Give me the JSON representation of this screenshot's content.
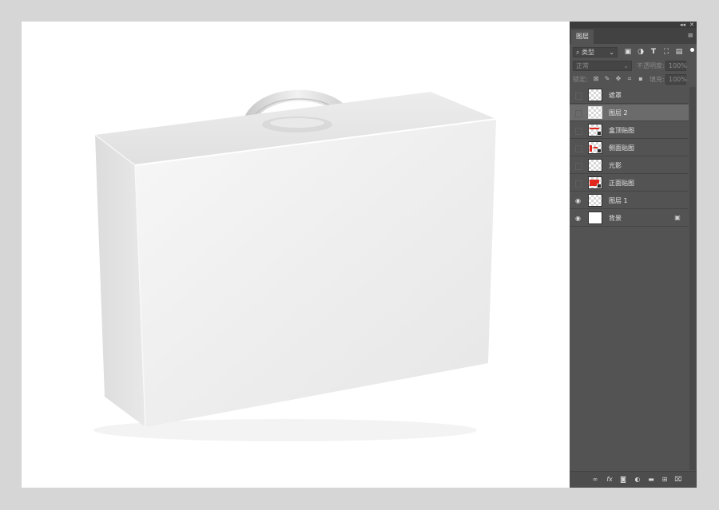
{
  "panel": {
    "collapse_glyph": "◂◂",
    "close_glyph": "✕",
    "tab_label": "图层",
    "menu_icon": "≡",
    "filter": {
      "kind_label": "类型",
      "icons": [
        "image-filter-icon",
        "adjustment-filter-icon",
        "type-filter-icon",
        "shape-filter-icon",
        "smart-object-filter-icon"
      ]
    },
    "blend_mode": "正常",
    "opacity_label": "不透明度:",
    "opacity_value": "100%",
    "lock_label": "锁定:",
    "fill_label": "填充:",
    "fill_value": "100%"
  },
  "layers": [
    {
      "name": "遮罩",
      "visible": false,
      "thumb": "transparent",
      "selected": false
    },
    {
      "name": "图层 2",
      "visible": false,
      "thumb": "transparent",
      "selected": true
    },
    {
      "name": "盒顶贴图",
      "visible": false,
      "thumb": "red-strip-smart",
      "selected": false
    },
    {
      "name": "侧面贴图",
      "visible": false,
      "thumb": "red-side-smart",
      "selected": false
    },
    {
      "name": "光影",
      "visible": false,
      "thumb": "transparent",
      "selected": false
    },
    {
      "name": "正面贴图",
      "visible": false,
      "thumb": "red-fill-smart",
      "selected": false
    },
    {
      "name": "图层 1",
      "visible": true,
      "thumb": "transparent",
      "selected": false
    },
    {
      "name": "背景",
      "visible": true,
      "thumb": "white",
      "selected": false,
      "locked": true
    }
  ],
  "glyphs": {
    "eye": "👁",
    "lock": "🔒",
    "link": "⚭",
    "fx": "fx",
    "mask": "◙",
    "adjust": "◐",
    "folder": "▆",
    "new_layer": "⊞",
    "trash": "🗑"
  },
  "colors": {
    "panel_bg": "#535353",
    "selected_row": "#6b6b6b",
    "accent_red": "#e0261d"
  }
}
